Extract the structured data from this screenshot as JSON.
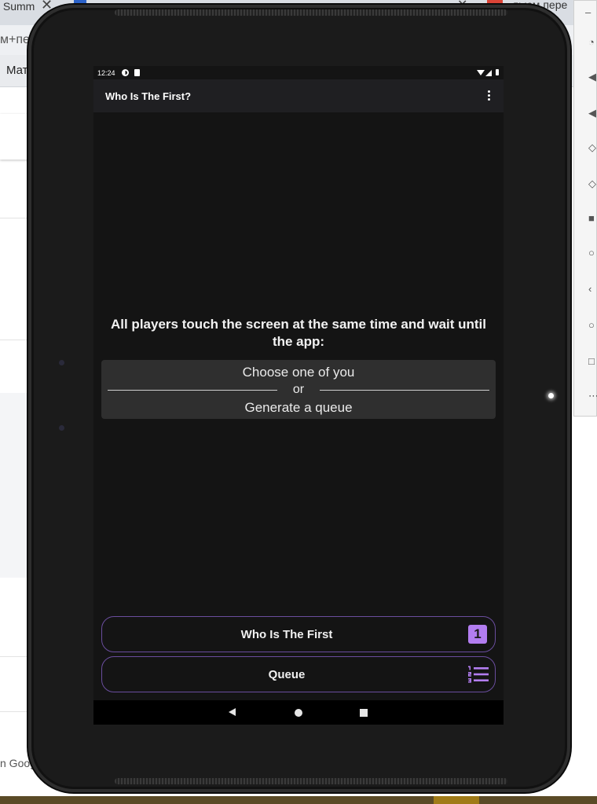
{
  "browser": {
    "tab_left": " Summ",
    "tab_right": "льюм пере",
    "address_fragment": "м+пер",
    "bookmark_fragment": "Мат",
    "footer_fragment": "n Googl"
  },
  "status_bar": {
    "time": "12:24"
  },
  "app_bar": {
    "title": "Who Is The First?"
  },
  "main": {
    "instruction": "All players touch the screen at the same time and wait until the app:",
    "option_1": "Choose one of you",
    "separator": "or",
    "option_2": "Generate a queue"
  },
  "buttons": {
    "who_is_first": "Who Is The First",
    "who_is_first_badge": "1",
    "queue": "Queue"
  },
  "colors": {
    "accent": "#b27df0",
    "button_border": "#6a4d9e",
    "screen_background": "#141414",
    "app_bar": "#1f1f22"
  },
  "icons": {
    "menu": "overflow-menu-icon",
    "first": "number-one-icon",
    "queue": "numbered-list-icon",
    "nav": [
      "back-icon",
      "home-icon",
      "recents-icon"
    ]
  }
}
